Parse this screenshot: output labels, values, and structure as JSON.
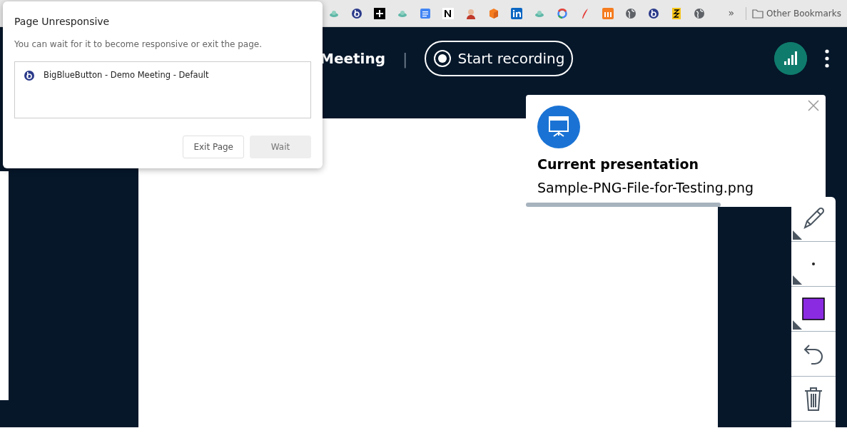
{
  "bookmarks_bar": {
    "overflow": "»",
    "folder": "Other Bookmarks"
  },
  "meeting_header": {
    "title": "Meeting",
    "separator": "|",
    "record_button": "Start recording"
  },
  "toast": {
    "title": "Current presentation",
    "file": "Sample-PNG-File-for-Testing.png",
    "level": 0.65
  },
  "toolbar": {
    "items": [
      {
        "kind": "pencil"
      },
      {
        "kind": "dot"
      },
      {
        "kind": "color",
        "color": "#8a2be2"
      },
      {
        "kind": "undo"
      },
      {
        "kind": "trash"
      }
    ]
  },
  "dialog": {
    "title": "Page Unresponsive",
    "message": "You can wait for it to become responsive or exit the page.",
    "pages": [
      "BigBlueButton - Demo Meeting - Default"
    ],
    "buttons": [
      {
        "label": "Exit Page",
        "kind": "secondary"
      },
      {
        "label": "Wait",
        "kind": "primary"
      }
    ]
  }
}
